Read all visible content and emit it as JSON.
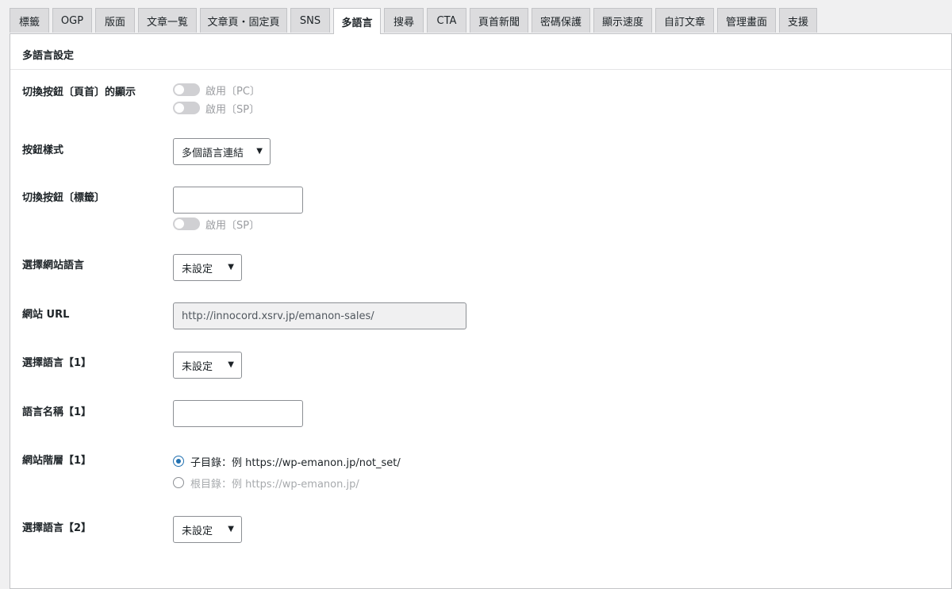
{
  "tabs": [
    {
      "label": "標籤",
      "active": false
    },
    {
      "label": "OGP",
      "active": false
    },
    {
      "label": "版面",
      "active": false
    },
    {
      "label": "文章一覧",
      "active": false
    },
    {
      "label": "文章頁・固定頁",
      "active": false
    },
    {
      "label": "SNS",
      "active": false
    },
    {
      "label": "多語言",
      "active": true
    },
    {
      "label": "搜尋",
      "active": false
    },
    {
      "label": "CTA",
      "active": false
    },
    {
      "label": "頁首新聞",
      "active": false
    },
    {
      "label": "密碼保護",
      "active": false
    },
    {
      "label": "顯示速度",
      "active": false
    },
    {
      "label": "自訂文章",
      "active": false
    },
    {
      "label": "管理畫面",
      "active": false
    },
    {
      "label": "支援",
      "active": false
    }
  ],
  "section": {
    "title": "多語言設定"
  },
  "fields": {
    "switch_display": {
      "label": "切換按鈕〔頁首〕的顯示",
      "toggle_pc": {
        "label": "啟用〔PC〕",
        "on": false
      },
      "toggle_sp": {
        "label": "啟用〔SP〕",
        "on": false
      }
    },
    "button_style": {
      "label": "按鈕樣式",
      "value": "多個語言連結"
    },
    "switch_tag": {
      "label": "切換按鈕〔標籤〕",
      "value": "",
      "toggle_sp": {
        "label": "啟用〔SP〕",
        "on": false
      }
    },
    "site_language": {
      "label": "選擇網站語言",
      "value": "未設定"
    },
    "site_url": {
      "label": "網站 URL",
      "value": "http://innocord.xsrv.jp/emanon-sales/"
    },
    "select_language_1": {
      "label": "選擇語言【1】",
      "value": "未設定"
    },
    "language_name_1": {
      "label": "語言名稱【1】",
      "value": ""
    },
    "site_hierarchy_1": {
      "label": "網站階層【1】",
      "option_subdir": {
        "label": "子目錄：例 https://wp-emanon.jp/not_set/",
        "checked": true
      },
      "option_root": {
        "label": "根目錄：例 https://wp-emanon.jp/",
        "checked": false
      }
    },
    "select_language_2": {
      "label": "選擇語言【2】",
      "value": "未設定"
    }
  },
  "colors": {
    "accent": "#2271b1",
    "tab_inactive": "#dcdcde",
    "toggle_off": "#d0d0d3",
    "panel_bg": "#ffffff",
    "page_bg": "#f0f0f1"
  },
  "icons": {
    "select_arrow": "dropdown-arrow-icon"
  }
}
